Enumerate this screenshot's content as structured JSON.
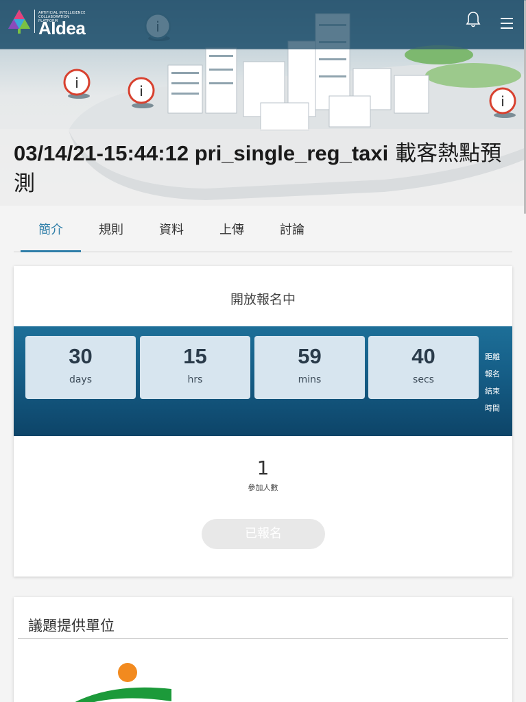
{
  "header": {
    "logo": {
      "tagline": "ARTIFICIAL INTELLIGENCE COLLABORATION PLATFORM",
      "brand": "AIdea"
    },
    "icons": [
      "bell-icon",
      "hamburger-menu-icon"
    ]
  },
  "competition": {
    "title_latin": "03/14/21-15:44:12 pri_single_reg_taxi",
    "title_cjk": " 載客熱點預測"
  },
  "tabs": [
    {
      "label": "簡介",
      "active": true
    },
    {
      "label": "規則",
      "active": false
    },
    {
      "label": "資料",
      "active": false
    },
    {
      "label": "上傳",
      "active": false
    },
    {
      "label": "討論",
      "active": false
    }
  ],
  "status": {
    "heading": "開放報名中",
    "countdown": [
      {
        "value": "30",
        "unit": "days"
      },
      {
        "value": "15",
        "unit": "hrs"
      },
      {
        "value": "59",
        "unit": "mins"
      },
      {
        "value": "40",
        "unit": "secs"
      }
    ],
    "countdown_caption": [
      "距離",
      "報名",
      "結束",
      "時間"
    ],
    "participants_count": "1",
    "participants_label": "參加人數",
    "register_button": "已報名"
  },
  "provider": {
    "heading": "議題提供單位"
  },
  "colors": {
    "accent": "#2f7ea8",
    "countdown_bg": "#155d86",
    "countdown_box": "#d7e5ef",
    "topbar": "#2c5670"
  }
}
